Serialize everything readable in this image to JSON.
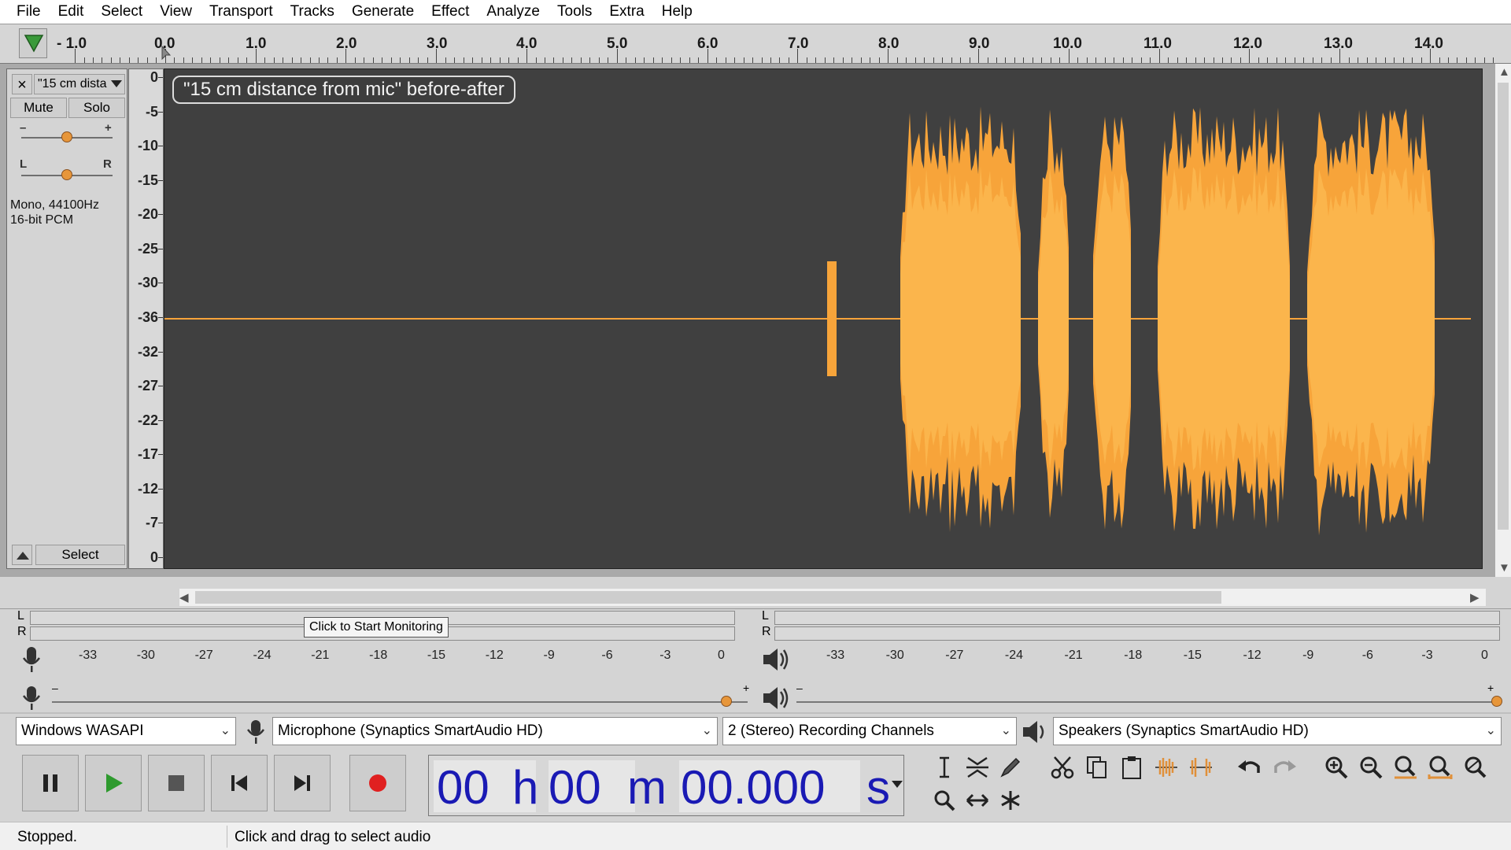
{
  "menu": [
    "File",
    "Edit",
    "Select",
    "View",
    "Transport",
    "Tracks",
    "Generate",
    "Effect",
    "Analyze",
    "Tools",
    "Extra",
    "Help"
  ],
  "ruler": {
    "labels": [
      "- 1.0",
      "0.0",
      "1.0",
      "2.0",
      "3.0",
      "4.0",
      "5.0",
      "6.0",
      "7.0",
      "8.0",
      "9.0",
      "10.0",
      "11.0",
      "12.0",
      "13.0",
      "14.0"
    ]
  },
  "track": {
    "name": "\"15 cm dista",
    "mute_label": "Mute",
    "solo_label": "Solo",
    "gain_minus": "–",
    "gain_plus": "+",
    "pan_left": "L",
    "pan_right": "R",
    "info_line1": "Mono, 44100Hz",
    "info_line2": "16-bit PCM",
    "select_label": "Select",
    "close_glyph": "×",
    "clip_label": "\"15 cm distance from mic\" before-after",
    "db_labels": [
      "0",
      "-5",
      "-10",
      "-15",
      "-20",
      "-25",
      "-30",
      "-36",
      "-32",
      "-27",
      "-22",
      "-17",
      "-12",
      "-7",
      "0"
    ]
  },
  "meters": {
    "record_scale": [
      "-33",
      "-30",
      "-27",
      "-24",
      "-21",
      "-18",
      "-15",
      "-12",
      "-9",
      "-6",
      "-3",
      "0"
    ],
    "play_scale": [
      "-33",
      "-30",
      "-27",
      "-24",
      "-21",
      "-18",
      "-15",
      "-12",
      "-9",
      "-6",
      "-3",
      "0"
    ],
    "monitor_tip": "Click to Start Monitoring",
    "channel_l": "L",
    "channel_r": "R",
    "vol_minus": "–",
    "vol_plus": "+"
  },
  "devices": {
    "host": "Windows WASAPI",
    "recording_device": "Microphone (Synaptics SmartAudio HD)",
    "channels": "2 (Stereo) Recording Channels",
    "playback_device": "Speakers (Synaptics SmartAudio HD)"
  },
  "time": {
    "hours": "00",
    "h": "h",
    "minutes": "00",
    "m": "m",
    "seconds": "00.000",
    "s": "s"
  },
  "status": {
    "state": "Stopped.",
    "hint": "Click and drag to select audio"
  },
  "colors": {
    "waveform": "#f7a43a",
    "waveform_light": "#fbb850",
    "record": "#e02020",
    "play": "#2e9a2e",
    "time_digits": "#1a1ab4"
  }
}
